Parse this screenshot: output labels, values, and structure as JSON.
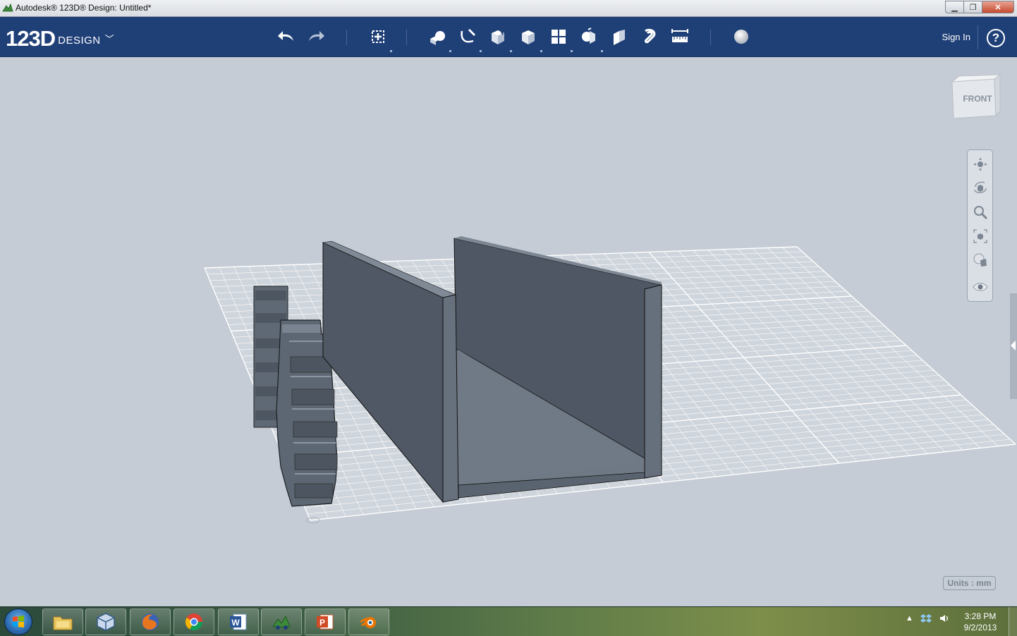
{
  "window": {
    "title": "Autodesk® 123D® Design: Untitled*",
    "controls": [
      "minimize-icon",
      "maximize-icon",
      "close-icon"
    ]
  },
  "toolbar": {
    "logo_main": "123D",
    "logo_sub": "DESIGN",
    "tools": [
      {
        "name": "undo",
        "icon": "undo-arrow-icon"
      },
      {
        "name": "redo",
        "icon": "redo-arrow-icon"
      },
      {
        "name": "transform",
        "icon": "transform-icon"
      },
      {
        "name": "primitives",
        "icon": "primitives-icon"
      },
      {
        "name": "sketch",
        "icon": "sketch-icon"
      },
      {
        "name": "construct",
        "icon": "construct-icon"
      },
      {
        "name": "modify",
        "icon": "modify-icon"
      },
      {
        "name": "pattern",
        "icon": "pattern-icon"
      },
      {
        "name": "grouping",
        "icon": "grouping-icon"
      },
      {
        "name": "combine",
        "icon": "combine-icon"
      },
      {
        "name": "snap",
        "icon": "snap-icon"
      },
      {
        "name": "measure",
        "icon": "measure-icon"
      },
      {
        "name": "material",
        "icon": "material-sphere-icon"
      }
    ],
    "sign_in": "Sign In",
    "help": "?"
  },
  "viewport": {
    "viewcube_label": "FRONT",
    "nav_tools": [
      "pan-icon",
      "orbit-icon",
      "zoom-icon",
      "fit-icon",
      "view-mode-icon",
      "visibility-icon"
    ],
    "units_label": "Units : mm",
    "grid_color": "#ffffff",
    "model_color": "#5a6470"
  },
  "taskbar": {
    "apps": [
      "windows-explorer-icon",
      "virtualbox-icon",
      "firefox-icon",
      "chrome-icon",
      "word-icon",
      "123d-design-icon",
      "powerpoint-icon",
      "blender-icon"
    ],
    "time": "3:28 PM",
    "date": "9/2/2013"
  }
}
